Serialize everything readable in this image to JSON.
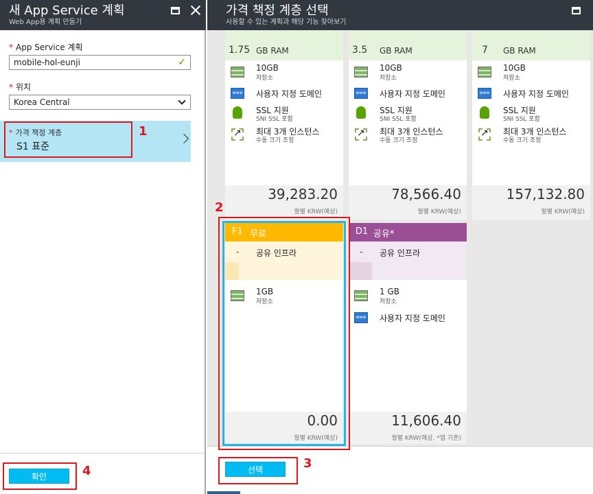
{
  "left_blade": {
    "title": "새 App Service 계획",
    "subtitle": "Web App용 계획 만들기",
    "plan_label": "App Service 계획",
    "plan_value": "mobile-hol-eunji",
    "location_label": "위치",
    "location_value": "Korea Central",
    "tier_label": "가격 책정 계층",
    "tier_value": "S1 표준",
    "required_mark": "*",
    "confirm_button": "확인"
  },
  "right_blade": {
    "title": "가격 책정 계층 선택",
    "subtitle": "사용할 수 있는 계획과 해당 기능 찾아보기",
    "select_button": "선택"
  },
  "cards_top": [
    {
      "ram": "1.75",
      "ram_unit": "GB RAM",
      "storage": "10GB",
      "storage_sub": "저장소",
      "domain": "사용자 지정 도메인",
      "ssl": "SSL 지원",
      "ssl_sub": "SNI SSL 포함",
      "scale": "최대 3개 인스턴스",
      "scale_sub": "수동 크기 조정",
      "price": "39,283.20",
      "price_note": "월별 KRW(예상)"
    },
    {
      "ram": "3.5",
      "ram_unit": "GB RAM",
      "storage": "10GB",
      "storage_sub": "저장소",
      "domain": "사용자 지정 도메인",
      "ssl": "SSL 지원",
      "ssl_sub": "SNI SSL 포함",
      "scale": "최대 3개 인스턴스",
      "scale_sub": "수동 크기 조정",
      "price": "78,566.40",
      "price_note": "월별 KRW(예상)"
    },
    {
      "ram": "7",
      "ram_unit": "GB RAM",
      "storage": "10GB",
      "storage_sub": "저장소",
      "domain": "사용자 지정 도메인",
      "ssl": "SSL 지원",
      "ssl_sub": "SNI SSL 포함",
      "scale": "최대 3개 인스턴스",
      "scale_sub": "수동 크기 조정",
      "price": "157,132.80",
      "price_note": "월별 KRW(예상)"
    }
  ],
  "card_f1": {
    "code": "F1",
    "name": "무료",
    "dash": "-",
    "infra": "공유 인프라",
    "storage": "1GB",
    "storage_sub": "저장소",
    "price": "0.00",
    "price_note": "월별 KRW(예상)",
    "color": "#ffb900"
  },
  "card_d1": {
    "code": "D1",
    "name": "공유*",
    "dash": "-",
    "infra": "공유 인프라",
    "storage": "1 GB",
    "storage_sub": "저장소",
    "domain": "사용자 지정 도메인",
    "price": "11,606.40",
    "price_note": "월별 KRW(예상, *앱 기준)",
    "color": "#9b4f96"
  },
  "icons": {
    "storage": "storage-icon",
    "domain": "www-icon",
    "ssl": "ssl-shield-icon",
    "scale": "scale-icon"
  },
  "callouts": [
    "1",
    "2",
    "3",
    "4"
  ],
  "colors": {
    "header": "#32383f",
    "accent": "#00bcf2",
    "selected": "#b3e5f5",
    "callout": "#e0161b"
  }
}
